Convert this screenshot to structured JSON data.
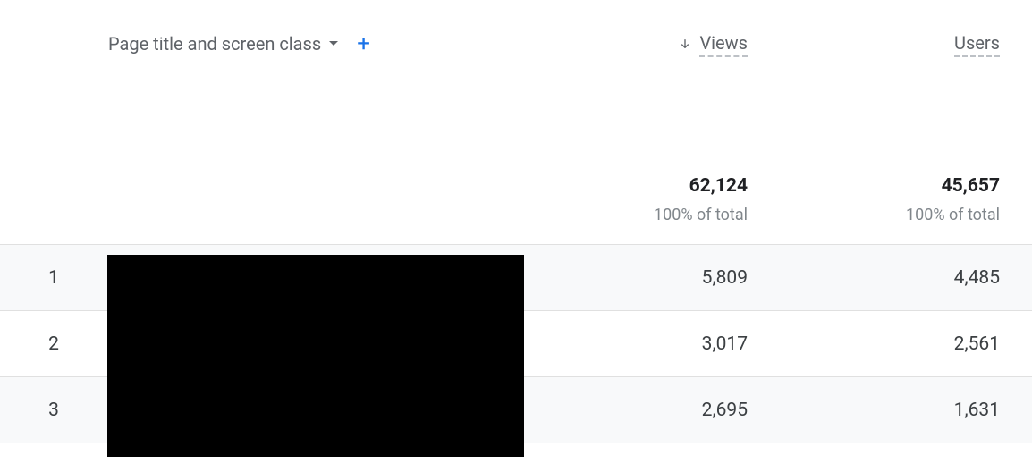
{
  "dimension": {
    "label": "Page title and screen class"
  },
  "metrics": [
    {
      "key": "views",
      "label": "Views",
      "sorted": true
    },
    {
      "key": "users",
      "label": "Users",
      "sorted": false
    }
  ],
  "totals": {
    "views": {
      "value": "62,124",
      "sub": "100% of total"
    },
    "users": {
      "value": "45,657",
      "sub": "100% of total"
    }
  },
  "rows": [
    {
      "index": "1",
      "views": "5,809",
      "users": "4,485"
    },
    {
      "index": "2",
      "views": "3,017",
      "users": "2,561"
    },
    {
      "index": "3",
      "views": "2,695",
      "users": "1,631"
    }
  ]
}
